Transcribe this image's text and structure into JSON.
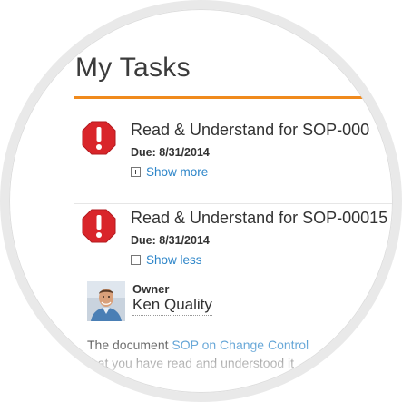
{
  "header": {
    "title": "My Tasks"
  },
  "tasks": [
    {
      "title": "Read & Understand for SOP-000",
      "due": "Due: 8/31/2014",
      "toggle_label": "Show more",
      "toggle_state": "collapsed"
    },
    {
      "title": "Read & Understand for SOP-00015",
      "due": "Due: 8/31/2014",
      "toggle_label": "Show less",
      "toggle_state": "expanded"
    }
  ],
  "owner": {
    "label": "Owner",
    "name": "Ken Quality"
  },
  "document": {
    "prefix": "The document ",
    "link": "SOP on Change Control",
    "line2": "that you have read and understood it"
  },
  "colors": {
    "accent_rule": "#f08a1d",
    "link": "#2e86c9",
    "alert_red": "#d9252a"
  },
  "icons": {
    "alert": "exclamation-circle-icon",
    "expand": "plus-box-icon",
    "collapse": "minus-box-icon"
  }
}
